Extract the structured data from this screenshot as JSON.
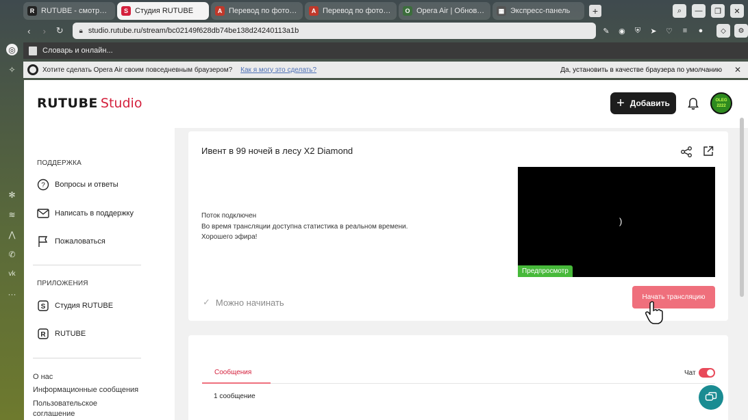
{
  "browser": {
    "tabs": [
      {
        "label": "RUTUBE - смотрите вид",
        "fav": "R",
        "fav_color": "#222222",
        "active": false
      },
      {
        "label": "Студия RUTUBE",
        "fav": "S",
        "fav_color": "#d4203c",
        "active": true
      },
      {
        "label": "Перевод по фото онла",
        "fav": "A",
        "fav_color": "#c0392b",
        "active": false
      },
      {
        "label": "Перевод по фото онла",
        "fav": "A",
        "fav_color": "#c0392b",
        "active": false
      },
      {
        "label": "Opera Air | Обновлени",
        "fav": "O",
        "fav_color": "#3c6e3c",
        "active": false
      },
      {
        "label": "Экспресс-панель",
        "fav": "▦",
        "fav_color": "#555555",
        "active": false
      }
    ],
    "url": "studio.rutube.ru/stream/bc02149f628db74be138d24240113a1b",
    "bookmark": "Словарь и онлайн...",
    "infobar": {
      "question": "Хотите сделать Opera Air своим повседневным браузером?",
      "link": "Как я могу это сделать?",
      "action": "Да, установить в качестве браузера по умолчанию"
    }
  },
  "studio": {
    "logo_main": "RUTUBE",
    "logo_sub": "Studio",
    "add_button": "Добавить",
    "avatar_text": "OLEG 2222",
    "nav": {
      "support_title": "ПОДДЕРЖКА",
      "support_items": [
        "Вопросы и ответы",
        "Написать в поддержку",
        "Пожаловаться"
      ],
      "apps_title": "ПРИЛОЖЕНИЯ",
      "apps_items": [
        "Студия RUTUBE",
        "RUTUBE"
      ],
      "footer_links": [
        "О нас",
        "Информационные сообщения",
        "Пользовательское",
        "соглашение"
      ]
    },
    "stream": {
      "title": "Ивент в 99 ночей в лесу X2 Diamond",
      "status_lines": [
        "Поток подключен",
        "Во время трансляции доступна статистика в реальном времени.",
        "Хорошего эфира!"
      ],
      "preview_label": "Предпросмотр",
      "preview_glyph": ")",
      "ready_text": "Можно начинать",
      "start_button": "Начать трансляцию"
    },
    "chat": {
      "tab_messages": "Сообщения",
      "chat_label": "Чат",
      "chat_enabled": true,
      "message_count": "1 сообщение"
    }
  },
  "colors": {
    "accent": "#d4203c",
    "start_button": "#ef6f7c",
    "preview_tag": "#47b93a",
    "fab": "#1a8c92"
  }
}
